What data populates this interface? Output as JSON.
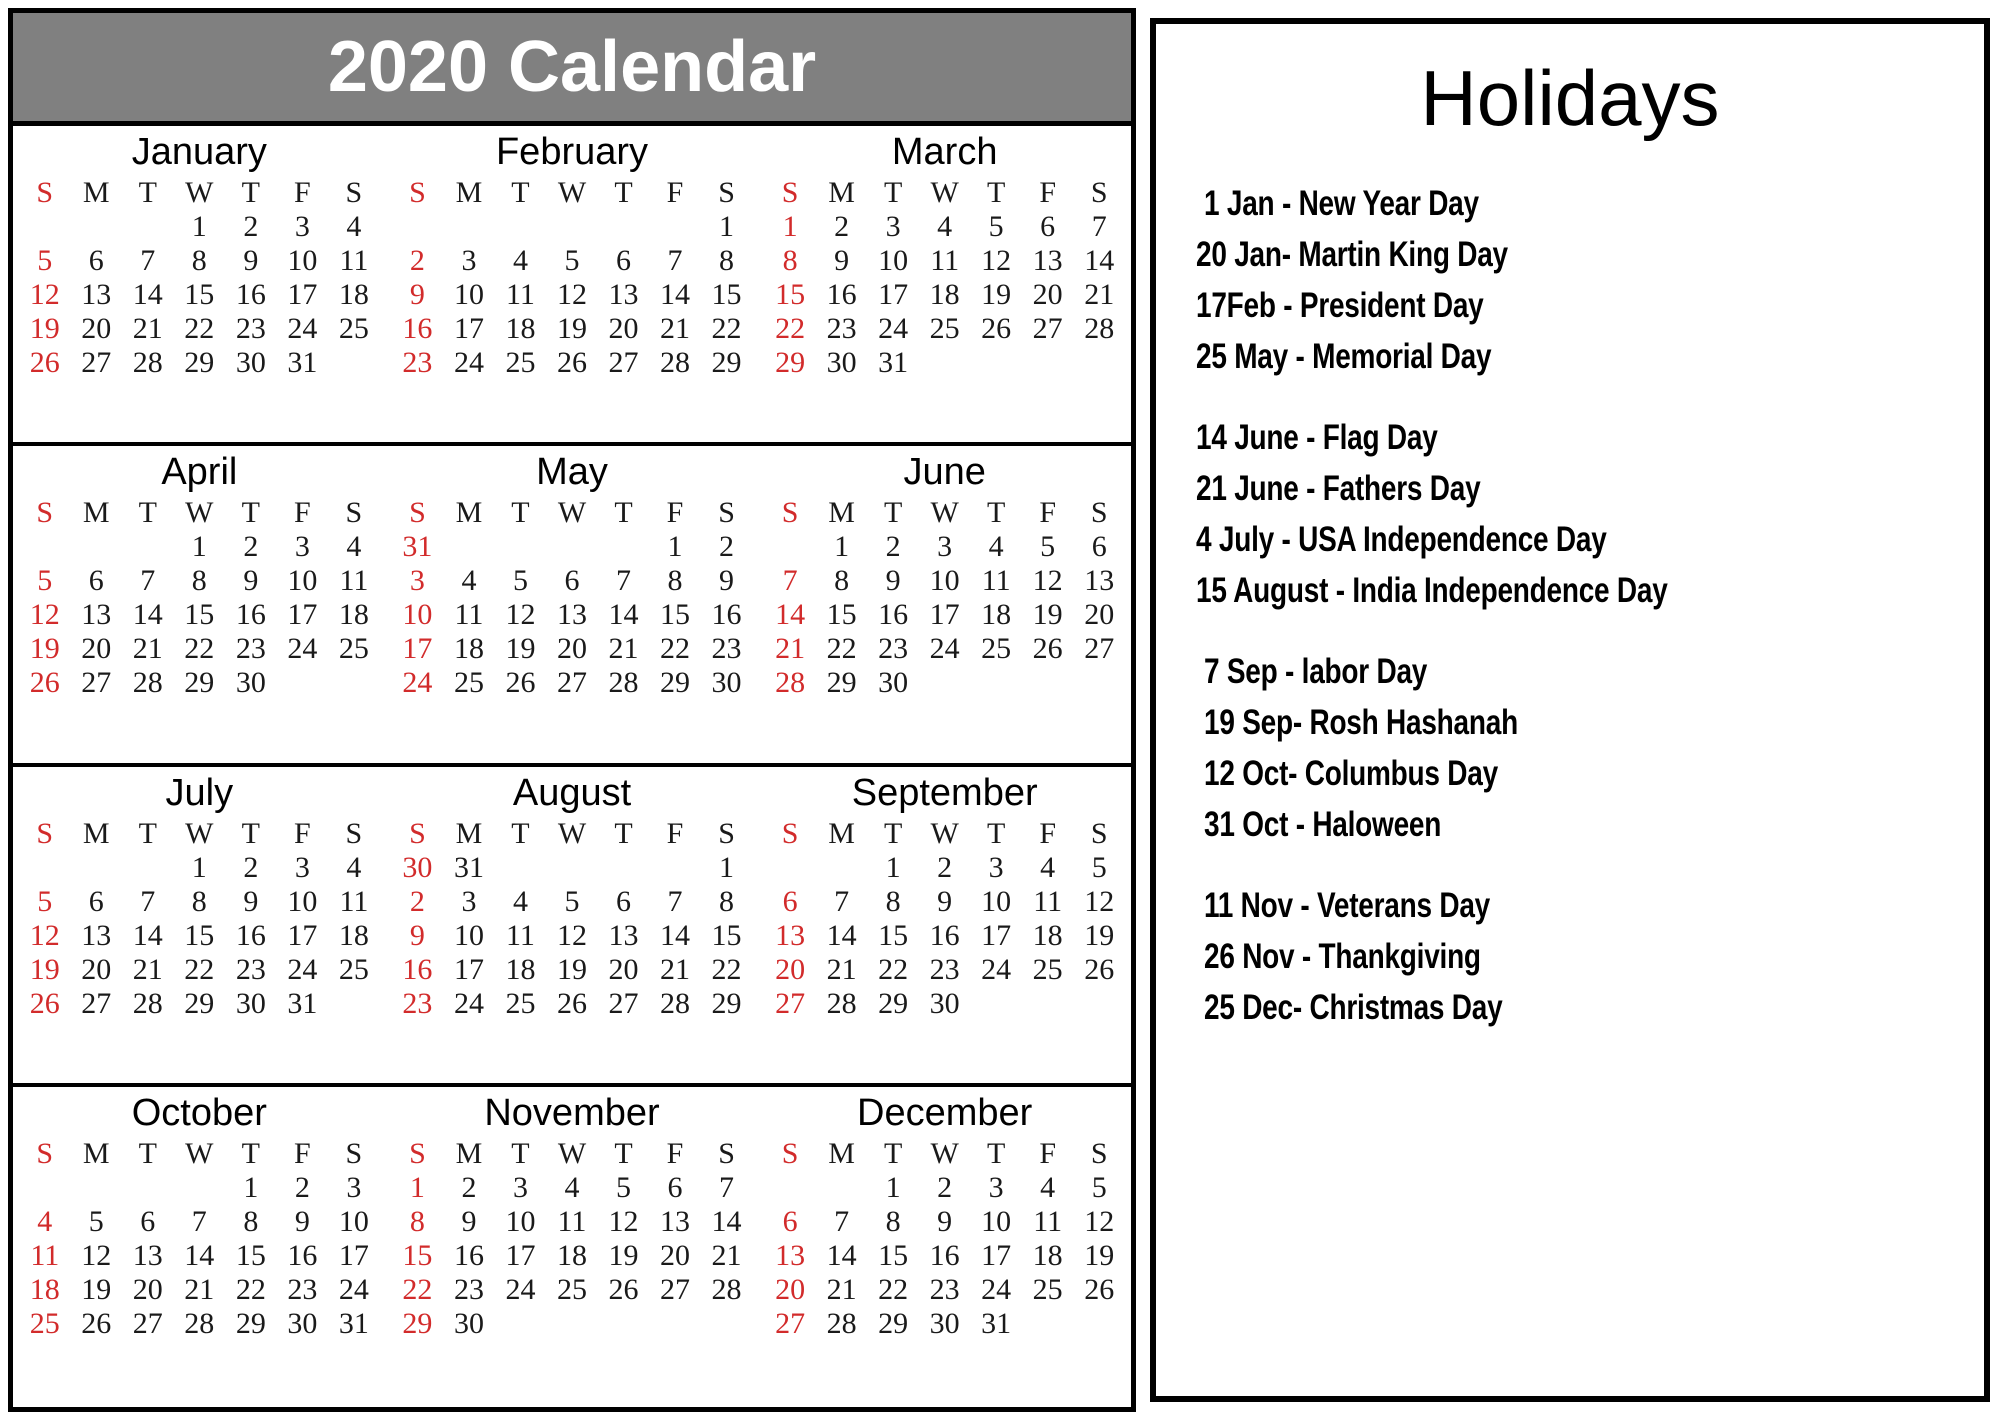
{
  "calendar": {
    "title": "2020 Calendar",
    "title_bar_color": "#808080",
    "sunday_color": "#d22b2b",
    "weekday_headers": [
      "S",
      "M",
      "T",
      "W",
      "T",
      "F",
      "S"
    ],
    "quarters": [
      {
        "months": [
          {
            "name": "January",
            "weeks": [
              [
                "",
                "",
                "",
                "1",
                "2",
                "3",
                "4"
              ],
              [
                "5",
                "6",
                "7",
                "8",
                "9",
                "10",
                "11"
              ],
              [
                "12",
                "13",
                "14",
                "15",
                "16",
                "17",
                "18"
              ],
              [
                "19",
                "20",
                "21",
                "22",
                "23",
                "24",
                "25"
              ],
              [
                "26",
                "27",
                "28",
                "29",
                "30",
                "31",
                ""
              ]
            ]
          },
          {
            "name": "February",
            "weeks": [
              [
                "",
                "",
                "",
                "",
                "",
                "",
                "1"
              ],
              [
                "2",
                "3",
                "4",
                "5",
                "6",
                "7",
                "8"
              ],
              [
                "9",
                "10",
                "11",
                "12",
                "13",
                "14",
                "15"
              ],
              [
                "16",
                "17",
                "18",
                "19",
                "20",
                "21",
                "22"
              ],
              [
                "23",
                "24",
                "25",
                "26",
                "27",
                "28",
                "29"
              ]
            ]
          },
          {
            "name": "March",
            "weeks": [
              [
                "1",
                "2",
                "3",
                "4",
                "5",
                "6",
                "7"
              ],
              [
                "8",
                "9",
                "10",
                "11",
                "12",
                "13",
                "14"
              ],
              [
                "15",
                "16",
                "17",
                "18",
                "19",
                "20",
                "21"
              ],
              [
                "22",
                "23",
                "24",
                "25",
                "26",
                "27",
                "28"
              ],
              [
                "29",
                "30",
                "31",
                "",
                "",
                "",
                ""
              ]
            ]
          }
        ]
      },
      {
        "months": [
          {
            "name": "April",
            "weeks": [
              [
                "",
                "",
                "",
                "1",
                "2",
                "3",
                "4"
              ],
              [
                "5",
                "6",
                "7",
                "8",
                "9",
                "10",
                "11"
              ],
              [
                "12",
                "13",
                "14",
                "15",
                "16",
                "17",
                "18"
              ],
              [
                "19",
                "20",
                "21",
                "22",
                "23",
                "24",
                "25"
              ],
              [
                "26",
                "27",
                "28",
                "29",
                "30",
                "",
                ""
              ]
            ]
          },
          {
            "name": "May",
            "weeks": [
              [
                "31",
                "",
                "",
                "",
                "",
                "1",
                "2"
              ],
              [
                "3",
                "4",
                "5",
                "6",
                "7",
                "8",
                "9"
              ],
              [
                "10",
                "11",
                "12",
                "13",
                "14",
                "15",
                "16"
              ],
              [
                "17",
                "18",
                "19",
                "20",
                "21",
                "22",
                "23"
              ],
              [
                "24",
                "25",
                "26",
                "27",
                "28",
                "29",
                "30"
              ]
            ]
          },
          {
            "name": "June",
            "weeks": [
              [
                "",
                "1",
                "2",
                "3",
                "4",
                "5",
                "6"
              ],
              [
                "7",
                "8",
                "9",
                "10",
                "11",
                "12",
                "13"
              ],
              [
                "14",
                "15",
                "16",
                "17",
                "18",
                "19",
                "20"
              ],
              [
                "21",
                "22",
                "23",
                "24",
                "25",
                "26",
                "27"
              ],
              [
                "28",
                "29",
                "30",
                "",
                "",
                "",
                ""
              ]
            ]
          }
        ]
      },
      {
        "months": [
          {
            "name": "July",
            "weeks": [
              [
                "",
                "",
                "",
                "1",
                "2",
                "3",
                "4"
              ],
              [
                "5",
                "6",
                "7",
                "8",
                "9",
                "10",
                "11"
              ],
              [
                "12",
                "13",
                "14",
                "15",
                "16",
                "17",
                "18"
              ],
              [
                "19",
                "20",
                "21",
                "22",
                "23",
                "24",
                "25"
              ],
              [
                "26",
                "27",
                "28",
                "29",
                "30",
                "31",
                ""
              ]
            ]
          },
          {
            "name": "August",
            "weeks": [
              [
                "30",
                "31",
                "",
                "",
                "",
                "",
                "1"
              ],
              [
                "2",
                "3",
                "4",
                "5",
                "6",
                "7",
                "8"
              ],
              [
                "9",
                "10",
                "11",
                "12",
                "13",
                "14",
                "15"
              ],
              [
                "16",
                "17",
                "18",
                "19",
                "20",
                "21",
                "22"
              ],
              [
                "23",
                "24",
                "25",
                "26",
                "27",
                "28",
                "29"
              ]
            ]
          },
          {
            "name": "September",
            "weeks": [
              [
                "",
                "",
                "1",
                "2",
                "3",
                "4",
                "5"
              ],
              [
                "6",
                "7",
                "8",
                "9",
                "10",
                "11",
                "12"
              ],
              [
                "13",
                "14",
                "15",
                "16",
                "17",
                "18",
                "19"
              ],
              [
                "20",
                "21",
                "22",
                "23",
                "24",
                "25",
                "26"
              ],
              [
                "27",
                "28",
                "29",
                "30",
                "",
                "",
                ""
              ]
            ]
          }
        ]
      },
      {
        "months": [
          {
            "name": "October",
            "weeks": [
              [
                "",
                "",
                "",
                "",
                "1",
                "2",
                "3"
              ],
              [
                "4",
                "5",
                "6",
                "7",
                "8",
                "9",
                "10"
              ],
              [
                "11",
                "12",
                "13",
                "14",
                "15",
                "16",
                "17"
              ],
              [
                "18",
                "19",
                "20",
                "21",
                "22",
                "23",
                "24"
              ],
              [
                "25",
                "26",
                "27",
                "28",
                "29",
                "30",
                "31"
              ]
            ]
          },
          {
            "name": "November",
            "weeks": [
              [
                "1",
                "2",
                "3",
                "4",
                "5",
                "6",
                "7"
              ],
              [
                "8",
                "9",
                "10",
                "11",
                "12",
                "13",
                "14"
              ],
              [
                "15",
                "16",
                "17",
                "18",
                "19",
                "20",
                "21"
              ],
              [
                "22",
                "23",
                "24",
                "25",
                "26",
                "27",
                "28"
              ],
              [
                "29",
                "30",
                "",
                "",
                "",
                "",
                ""
              ]
            ]
          },
          {
            "name": "December",
            "weeks": [
              [
                "",
                "",
                "1",
                "2",
                "3",
                "4",
                "5"
              ],
              [
                "6",
                "7",
                "8",
                "9",
                "10",
                "11",
                "12"
              ],
              [
                "13",
                "14",
                "15",
                "16",
                "17",
                "18",
                "19"
              ],
              [
                "20",
                "21",
                "22",
                "23",
                "24",
                "25",
                "26"
              ],
              [
                "27",
                "28",
                "29",
                "30",
                "31",
                "",
                ""
              ]
            ]
          }
        ]
      }
    ]
  },
  "holidays": {
    "title": "Holidays",
    "items": [
      {
        "text": "1 Jan -  New Year Day",
        "gap_before": false,
        "indent": 1
      },
      {
        "text": "20 Jan-  Martin King Day",
        "gap_before": false,
        "indent": 0
      },
      {
        "text": "17Feb -  President Day",
        "gap_before": false,
        "indent": 0
      },
      {
        "text": "25 May - Memorial Day",
        "gap_before": false,
        "indent": 0
      },
      {
        "text": "14 June - Flag Day",
        "gap_before": true,
        "indent": 0
      },
      {
        "text": "21 June -  Fathers Day",
        "gap_before": false,
        "indent": 0
      },
      {
        "text": "4 July  - USA Independence Day",
        "gap_before": false,
        "indent": 0
      },
      {
        "text": "15 August - India Independence Day",
        "gap_before": false,
        "indent": 0
      },
      {
        "text": "7 Sep - labor Day",
        "gap_before": true,
        "indent": 1
      },
      {
        "text": "19 Sep- Rosh Hashanah",
        "gap_before": false,
        "indent": 1
      },
      {
        "text": "12 Oct- Columbus Day",
        "gap_before": false,
        "indent": 1
      },
      {
        "text": "31 Oct - Haloween",
        "gap_before": false,
        "indent": 1
      },
      {
        "text": "11 Nov - Veterans Day",
        "gap_before": true,
        "indent": 1
      },
      {
        "text": "26 Nov - Thankgiving",
        "gap_before": false,
        "indent": 1
      },
      {
        "text": "25 Dec- Christmas Day",
        "gap_before": false,
        "indent": 1
      }
    ]
  }
}
